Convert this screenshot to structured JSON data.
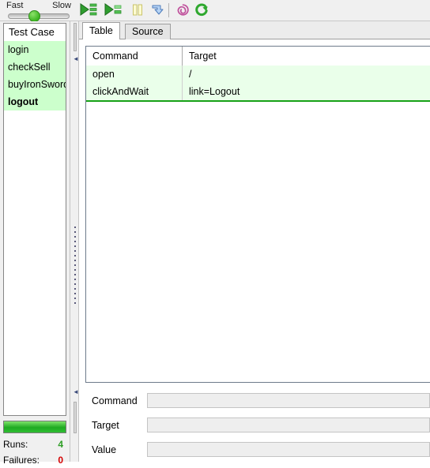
{
  "toolbar": {
    "slider": {
      "fast_label": "Fast",
      "slow_label": "Slow",
      "thumb_position_percent": 36
    },
    "buttons": [
      {
        "name": "run-all-tests-button",
        "icon": "play-all-icon",
        "title": "Play entire test suite",
        "enabled": true
      },
      {
        "name": "run-current-test-button",
        "icon": "play-current-icon",
        "title": "Play current test case",
        "enabled": true
      },
      {
        "name": "pause-button",
        "icon": "pause-icon",
        "title": "Pause",
        "enabled": false
      },
      {
        "name": "step-button",
        "icon": "step-icon",
        "title": "Step",
        "enabled": true
      },
      {
        "name": "rollup-button",
        "icon": "rollup-spiral-icon",
        "title": "Apply rollup rules",
        "enabled": true
      },
      {
        "name": "record-button",
        "icon": "record-circular-arrow-icon",
        "title": "Record",
        "enabled": true
      }
    ]
  },
  "sidebar": {
    "header": "Test Case",
    "items": [
      {
        "label": "login",
        "selected": false
      },
      {
        "label": "checkSell",
        "selected": false
      },
      {
        "label": "buyIronSword",
        "selected": false
      },
      {
        "label": "logout",
        "selected": true
      }
    ],
    "progress": {
      "percent": 100,
      "color": "#2fbe33"
    },
    "stats": [
      {
        "label": "Runs:",
        "value": "4",
        "color": "#2e9e26"
      },
      {
        "label": "Failures:",
        "value": "0",
        "color": "#d40000"
      }
    ]
  },
  "main": {
    "tabs": [
      {
        "label": "Table",
        "active": true
      },
      {
        "label": "Source",
        "active": false
      }
    ],
    "table": {
      "columns": [
        "Command",
        "Target"
      ],
      "rows": [
        {
          "command": "open",
          "target": "/"
        },
        {
          "command": "clickAndWait",
          "target": "link=Logout"
        }
      ]
    },
    "editor": {
      "fields": [
        {
          "label": "Command",
          "value": "",
          "placeholder": ""
        },
        {
          "label": "Target",
          "value": "",
          "placeholder": ""
        },
        {
          "label": "Value",
          "value": "",
          "placeholder": ""
        }
      ]
    }
  }
}
